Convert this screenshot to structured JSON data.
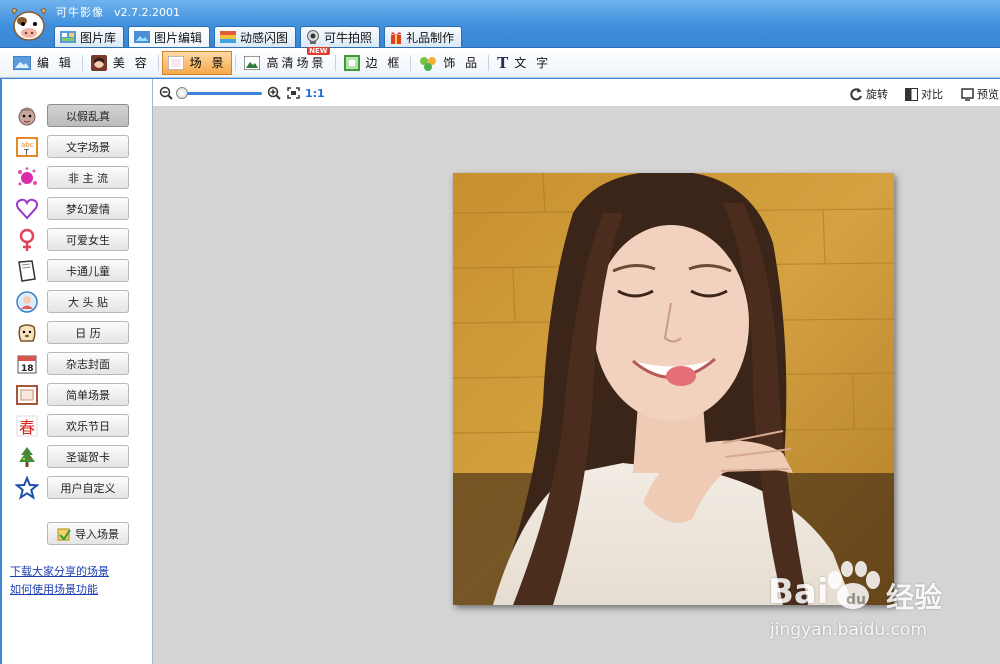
{
  "app": {
    "title": "可牛影像",
    "version": "v2.7.2.2001"
  },
  "main_tabs": [
    {
      "label": "图片库",
      "icon": "gallery-icon"
    },
    {
      "label": "图片编辑",
      "icon": "edit-picture-icon",
      "active": true
    },
    {
      "label": "动感闪图",
      "icon": "animation-icon"
    },
    {
      "label": "可牛拍照",
      "icon": "webcam-icon"
    },
    {
      "label": "礼品制作",
      "icon": "gift-icon"
    }
  ],
  "sub_tools": [
    {
      "label": "编 辑",
      "icon": "edit-icon"
    },
    {
      "label": "美 容",
      "icon": "beauty-icon"
    },
    {
      "label": "场 景",
      "icon": "scene-icon",
      "active": true
    },
    {
      "label": "高清场景",
      "icon": "hd-scene-icon",
      "badge": "NEW"
    },
    {
      "label": "边 框",
      "icon": "frame-icon"
    },
    {
      "label": "饰 品",
      "icon": "ornament-icon"
    },
    {
      "label": "文 字",
      "icon": "text-icon"
    }
  ],
  "scene_categories": [
    {
      "label": "以假乱真",
      "icon": "fake-real-icon",
      "active": true
    },
    {
      "label": "文字场景",
      "icon": "text-scene-icon"
    },
    {
      "label": "非 主 流",
      "icon": "nonmainstream-icon"
    },
    {
      "label": "梦幻爱情",
      "icon": "heart-icon"
    },
    {
      "label": "可爱女生",
      "icon": "female-icon"
    },
    {
      "label": "卡通儿童",
      "icon": "cartoon-book-icon"
    },
    {
      "label": "大 头 贴",
      "icon": "photo-sticker-icon"
    },
    {
      "label": "日  历",
      "icon": "calendar-dog-icon"
    },
    {
      "label": "杂志封面",
      "icon": "magazine-calendar-icon"
    },
    {
      "label": "简单场景",
      "icon": "simple-frame-icon"
    },
    {
      "label": "欢乐节日",
      "icon": "festival-icon"
    },
    {
      "label": "圣诞贺卡",
      "icon": "christmas-tree-icon"
    },
    {
      "label": "用户自定义",
      "icon": "star-icon"
    }
  ],
  "import_button": {
    "label": "导入场景",
    "icon": "import-icon"
  },
  "links": {
    "download": "下载大家分享的场景",
    "howto": "如何使用场景功能"
  },
  "view_toolbar": {
    "zoom_ratio_label": "1:1",
    "zoom_level": 0.0,
    "rotate": "旋转",
    "compare": "对比",
    "preview": "预览"
  },
  "watermark": {
    "brand": "Bai",
    "brand2": "经验",
    "url": "jingyan.baidu.com"
  },
  "colors": {
    "title_blue": "#3f8fdc",
    "active_orange": "#f6a94a",
    "link_blue": "#1d3fb0",
    "canvas_gray": "#d4d4d4"
  }
}
